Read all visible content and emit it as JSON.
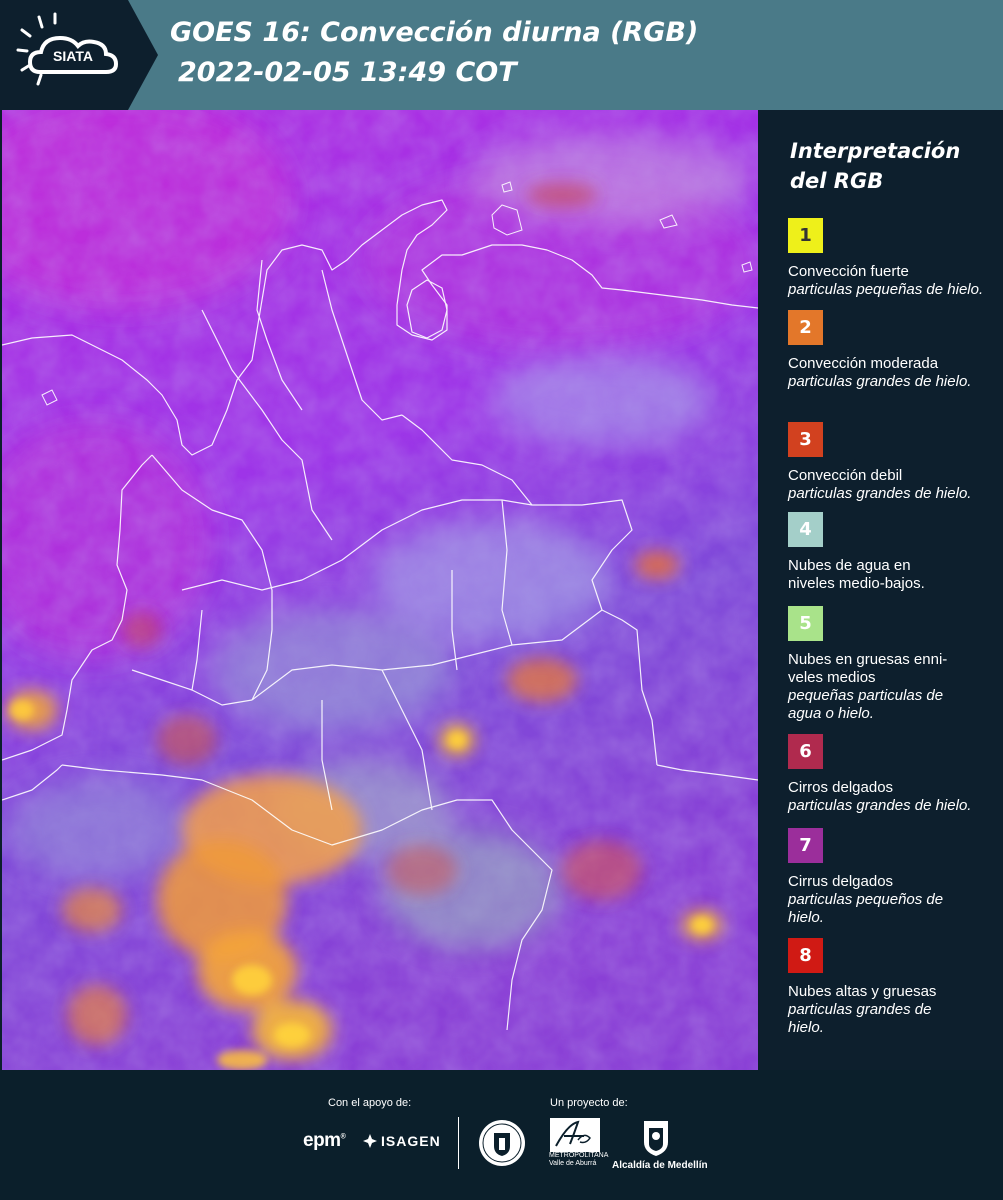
{
  "header": {
    "logo_text": "SIATA",
    "title_line1": "GOES 16: Convección diurna (RGB)",
    "title_line2": "2022-02-05 13:49 COT",
    "background_color": "#4a7a88"
  },
  "legend": {
    "title": "Interpretación del RGB",
    "items": [
      {
        "number": "1",
        "name": "Convección fuerte",
        "desc": "particulas pequeñas de hielo.",
        "color": "#eef01a",
        "text_color": "#333333"
      },
      {
        "number": "2",
        "name": "Convección moderada",
        "desc": "particulas grandes de hielo.",
        "color": "#e3772a",
        "text_color": "#ffffff"
      },
      {
        "number": "3",
        "name": "Convección debil",
        "desc": "particulas grandes de hielo.",
        "color": "#d2411f",
        "text_color": "#ffffff"
      },
      {
        "number": "4",
        "name": "Nubes de agua en niveles medio-bajos.",
        "desc": "",
        "color": "#a4cfc9",
        "text_color": "#ffffff"
      },
      {
        "number": "5",
        "name": "Nubes en gruesas enni-veles medios",
        "desc": "pequeñas particulas de agua o hielo.",
        "color": "#a9e38a",
        "text_color": "#ffffff"
      },
      {
        "number": "6",
        "name": "Cirros delgados",
        "desc": "particulas grandes de hielo.",
        "color": "#b02a4e",
        "text_color": "#ffffff"
      },
      {
        "number": "7",
        "name": "Cirrus delgados",
        "desc": "particulas pequeños de hielo.",
        "color": "#9b2e9b",
        "text_color": "#ffffff"
      },
      {
        "number": "8",
        "name": "Nubes altas y gruesas",
        "desc": "particulas grandes de hielo.",
        "color": "#d01a14",
        "text_color": "#ffffff"
      }
    ]
  },
  "footer": {
    "support_label": "Con el apoyo de:",
    "project_label": "Un proyecto de:",
    "sponsor_epm": "epm",
    "sponsor_isagen": "ISAGEN",
    "area_sub_1": "METROPOLITANA",
    "area_sub_2": "Valle de Aburrá",
    "alcaldia": "Alcaldía de Medellín"
  },
  "map": {
    "base_color": "#9a2ee6",
    "ocean_color": "#b52fe0"
  }
}
